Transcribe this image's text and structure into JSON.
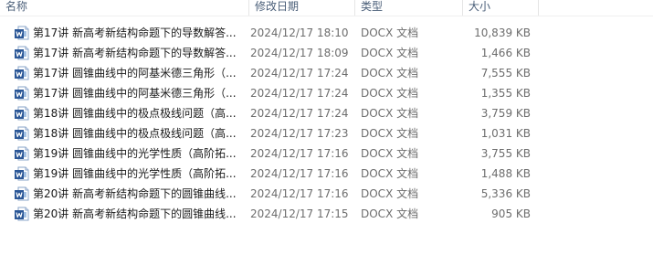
{
  "columns": {
    "name": "名称",
    "date": "修改日期",
    "type": "类型",
    "size": "大小"
  },
  "icons": {
    "file_icon": "word-document-icon",
    "accent": "#2b5797",
    "accent_light": "#4a86c8"
  },
  "files": [
    {
      "name": "第17讲 新高考新结构命题下的导数解答...",
      "date": "2024/12/17 18:10",
      "type": "DOCX 文档",
      "size": "10,839 KB"
    },
    {
      "name": "第17讲 新高考新结构命题下的导数解答...",
      "date": "2024/12/17 18:09",
      "type": "DOCX 文档",
      "size": "1,466 KB"
    },
    {
      "name": "第17讲 圆锥曲线中的阿基米德三角形（...",
      "date": "2024/12/17 17:24",
      "type": "DOCX 文档",
      "size": "7,555 KB"
    },
    {
      "name": "第17讲 圆锥曲线中的阿基米德三角形（...",
      "date": "2024/12/17 17:24",
      "type": "DOCX 文档",
      "size": "1,355 KB"
    },
    {
      "name": "第18讲 圆锥曲线中的极点极线问题（高...",
      "date": "2024/12/17 17:24",
      "type": "DOCX 文档",
      "size": "3,759 KB"
    },
    {
      "name": "第18讲 圆锥曲线中的极点极线问题（高...",
      "date": "2024/12/17 17:23",
      "type": "DOCX 文档",
      "size": "1,031 KB"
    },
    {
      "name": "第19讲 圆锥曲线中的光学性质（高阶拓...",
      "date": "2024/12/17 17:16",
      "type": "DOCX 文档",
      "size": "3,755 KB"
    },
    {
      "name": "第19讲 圆锥曲线中的光学性质（高阶拓...",
      "date": "2024/12/17 17:16",
      "type": "DOCX 文档",
      "size": "1,488 KB"
    },
    {
      "name": "第20讲 新高考新结构命题下的圆锥曲线...",
      "date": "2024/12/17 17:16",
      "type": "DOCX 文档",
      "size": "5,336 KB"
    },
    {
      "name": "第20讲 新高考新结构命题下的圆锥曲线...",
      "date": "2024/12/17 17:15",
      "type": "DOCX 文档",
      "size": "905 KB"
    }
  ]
}
